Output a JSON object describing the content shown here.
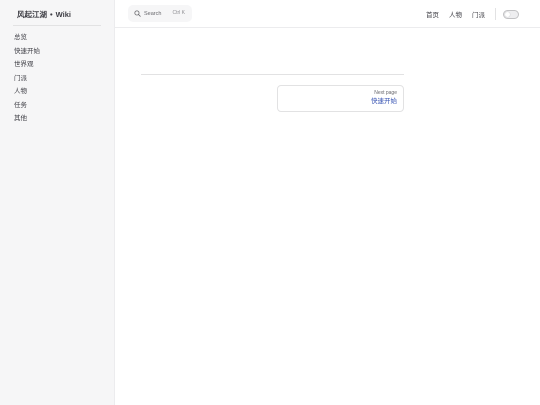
{
  "sidebar": {
    "site_title": "风起江湖",
    "title_separator": "•",
    "site_subtitle": "Wiki",
    "items": [
      {
        "label": "总览"
      },
      {
        "label": "快速开始"
      },
      {
        "label": "世界观"
      },
      {
        "label": "门派"
      },
      {
        "label": "人物"
      },
      {
        "label": "任务"
      },
      {
        "label": "其他"
      }
    ]
  },
  "header": {
    "search": {
      "label": "Search",
      "shortcut": "Ctrl K",
      "icon": "search-icon"
    },
    "nav": [
      {
        "label": "首页"
      },
      {
        "label": "人物"
      },
      {
        "label": "门派"
      }
    ],
    "theme_toggle_icon": "theme-toggle"
  },
  "pager": {
    "next_desc": "Next page",
    "next_title": "快速开始"
  },
  "colors": {
    "sidebar_bg": "#f6f6f7",
    "brand": "#3451b2",
    "text": "#3c3c43",
    "divider": "#e2e2e3"
  }
}
